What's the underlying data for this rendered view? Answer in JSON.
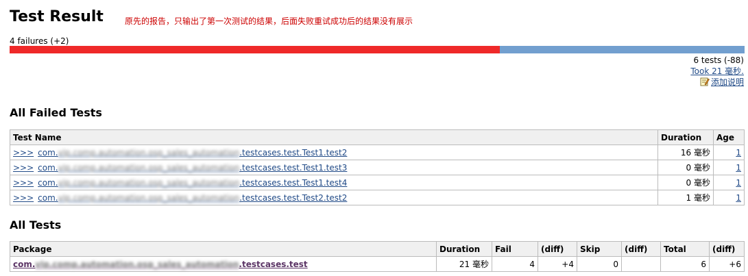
{
  "header": {
    "title": "Test Result",
    "annotation": "原先的报告，只输出了第一次测试的结果，后面失败重试成功后的结果没有展示",
    "failures_summary": "4 failures (+2)"
  },
  "progress": {
    "fail_fraction": 0.667,
    "fail_color": "#ef2929",
    "pass_color": "#729fcf"
  },
  "summary": {
    "tests": "6 tests (-88)",
    "took": "Took 21 毫秒.",
    "add_description": "添加说明"
  },
  "failed": {
    "title": "All Failed Tests",
    "columns": {
      "name": "Test Name",
      "duration": "Duration",
      "age": "Age"
    },
    "rows": [
      {
        "arrow": ">>>",
        "prefix": "com.",
        "suffix": ".testcases.test.Test1.test2",
        "duration": "16 毫秒",
        "age": "1"
      },
      {
        "arrow": ">>>",
        "prefix": "com.",
        "suffix": ".testcases.test.Test1.test3",
        "duration": "0 毫秒",
        "age": "1"
      },
      {
        "arrow": ">>>",
        "prefix": "com.",
        "suffix": ".testcases.test.Test1.test4",
        "duration": "0 毫秒",
        "age": "1"
      },
      {
        "arrow": ">>>",
        "prefix": "com.",
        "suffix": ".testcases.test.Test2.test2",
        "duration": "1 毫秒",
        "age": "1"
      }
    ]
  },
  "all": {
    "title": "All Tests",
    "columns": {
      "package": "Package",
      "duration": "Duration",
      "fail": "Fail",
      "fail_diff": "(diff)",
      "skip": "Skip",
      "skip_diff": "(diff)",
      "total": "Total",
      "total_diff": "(diff)"
    },
    "row": {
      "prefix": "com.",
      "suffix": ".testcases.test",
      "duration": "21 毫秒",
      "fail": "4",
      "fail_diff": "+4",
      "skip": "0",
      "skip_diff": "",
      "total": "6",
      "total_diff": "+6"
    }
  }
}
